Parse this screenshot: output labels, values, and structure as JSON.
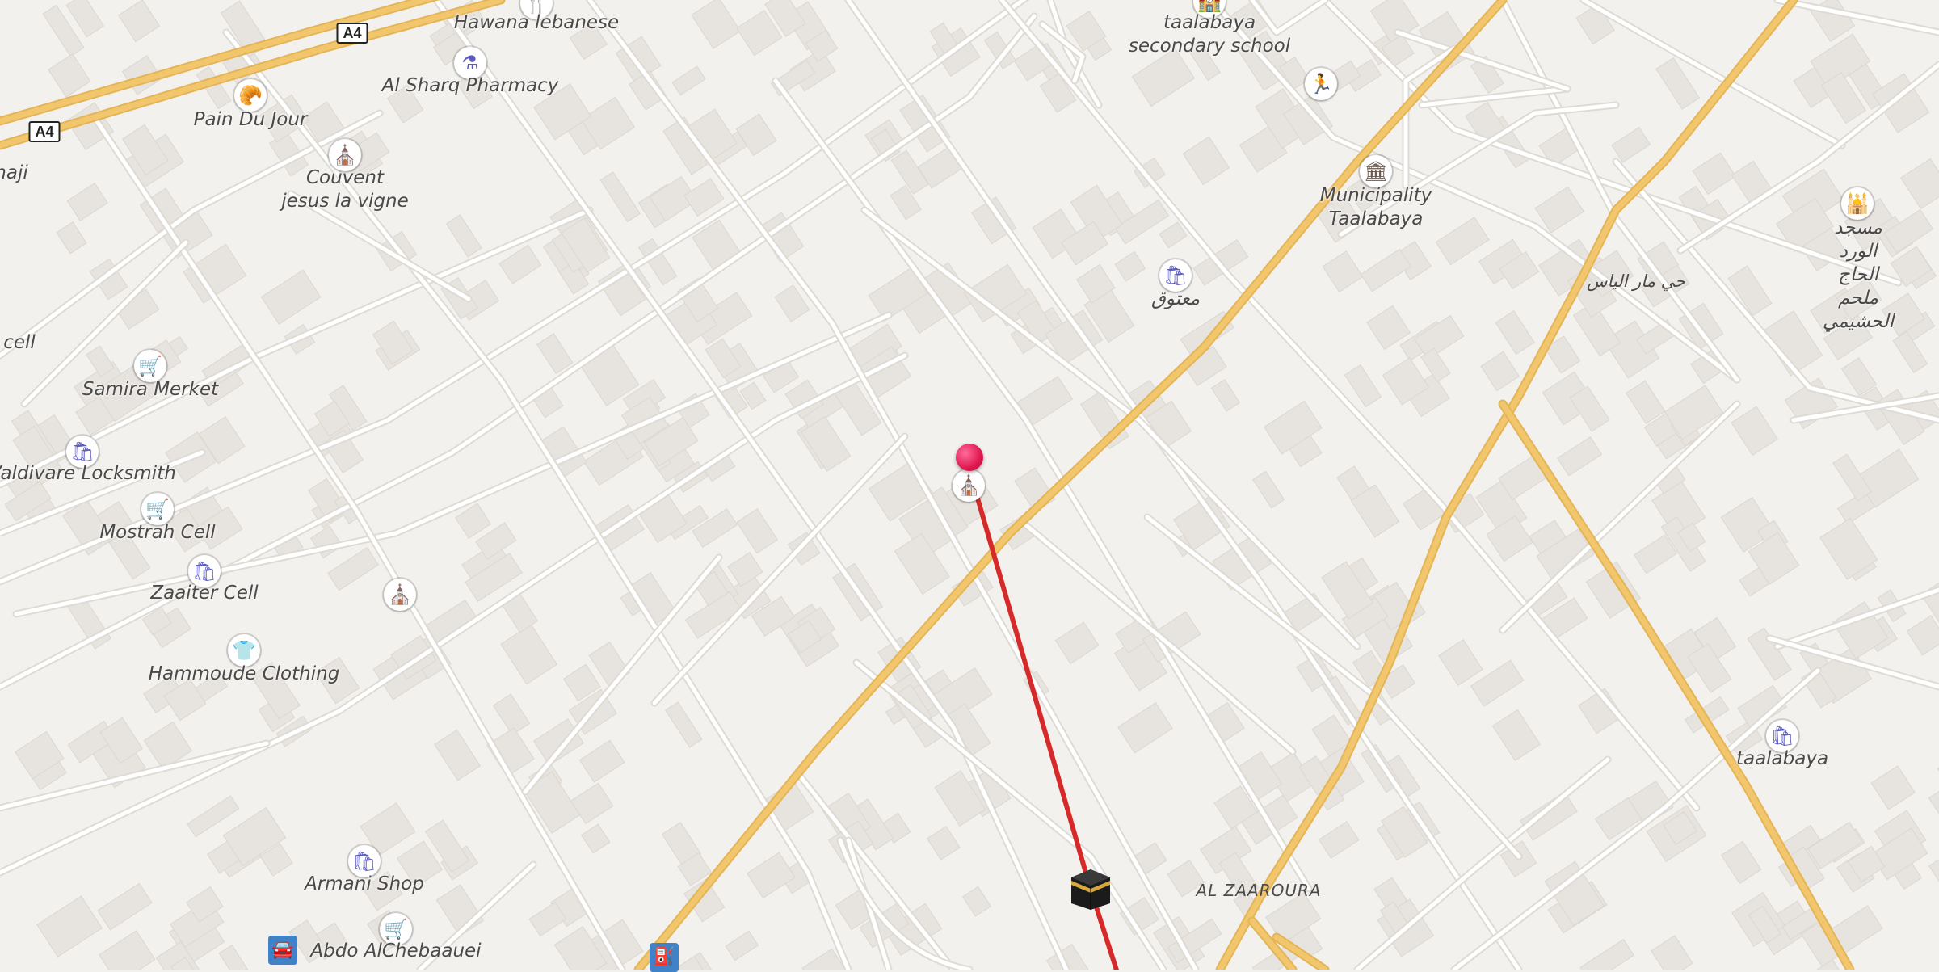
{
  "road_shields": [
    {
      "id": "a4-top",
      "text": "A4"
    },
    {
      "id": "a4-left",
      "text": "A4"
    }
  ],
  "area_labels": {
    "al_zaaroura": "AL ZAAROURA",
    "arabic_area": "حي مار الياس",
    "partial_left_1": "haji",
    "partial_left_2": "cell"
  },
  "pois": [
    {
      "name": "Hawana lebanese",
      "type": "restaurant",
      "icon": "fork-knife-icon"
    },
    {
      "name": "Al Sharq Pharmacy",
      "type": "pharmacy",
      "icon": "mortar-pestle-icon"
    },
    {
      "name": "Pain Du Jour",
      "type": "bakery",
      "icon": "bakery-icon"
    },
    {
      "name": "Couvent\njesus la vigne",
      "type": "landmark",
      "icon": "landmark-icon"
    },
    {
      "name": "taalabaya\nsecondary school",
      "type": "school",
      "icon": "school-icon"
    },
    {
      "name": "Municipality\nTaalabaya",
      "type": "government",
      "icon": "government-building-icon"
    },
    {
      "name": "مسجد الورد الحاج\nملحم الحشيمي",
      "type": "mosque",
      "icon": "mosque-icon"
    },
    {
      "name": "معتوق",
      "type": "shop",
      "icon": "shopping-bag-icon"
    },
    {
      "name": "Samira Merket",
      "type": "supermarket",
      "icon": "shopping-cart-icon"
    },
    {
      "name": "Valdivare Locksmith",
      "type": "shop",
      "icon": "shopping-bag-icon"
    },
    {
      "name": "Mostrah Cell",
      "type": "supermarket",
      "icon": "shopping-cart-icon"
    },
    {
      "name": "Zaaiter Cell",
      "type": "shop",
      "icon": "shopping-bag-icon"
    },
    {
      "name": "Hammoude Clothing",
      "type": "clothing",
      "icon": "tshirt-icon"
    },
    {
      "name": "Armani Shop",
      "type": "shop",
      "icon": "shopping-bag-icon"
    },
    {
      "name": "Abdo AlChebaauei",
      "type": "supermarket",
      "icon": "shopping-cart-icon"
    },
    {
      "name": "taalabaya",
      "type": "shop",
      "icon": "shopping-bag-icon"
    },
    {
      "name": "",
      "type": "landmark",
      "icon": "landmark-icon"
    },
    {
      "name": "",
      "type": "landmark",
      "icon": "landmark-icon"
    },
    {
      "name": "",
      "type": "sport",
      "icon": "running-person-icon"
    },
    {
      "name": "",
      "type": "car",
      "icon": "car-icon"
    },
    {
      "name": "",
      "type": "fuel",
      "icon": "fuel-pump-icon"
    }
  ],
  "markers": {
    "pin": "location-pin-icon",
    "destination": "kaaba-icon",
    "route_color": "#d62a2a"
  },
  "colors": {
    "background": "#f3f1ee",
    "building": "#e7e3de",
    "road_minor": "#ffffff",
    "road_major": "#f2c66d",
    "highway": "#f2c66d",
    "poi_shop": "#5b5bc0",
    "poi_food": "#e08a18"
  }
}
